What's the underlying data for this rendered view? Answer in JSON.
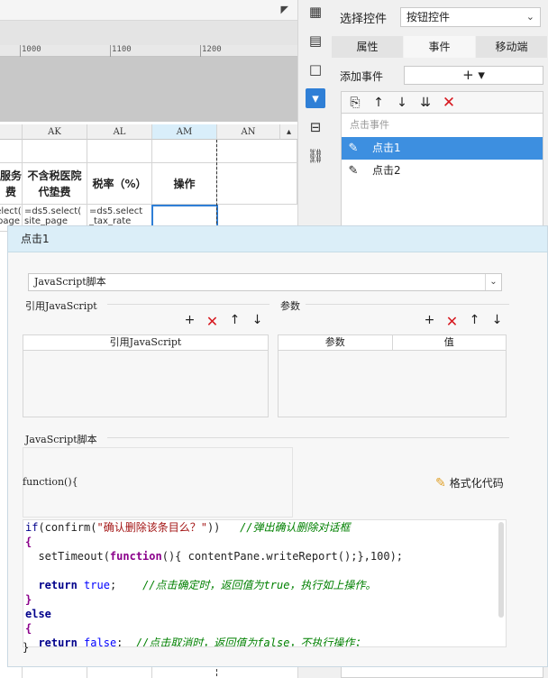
{
  "editor": {
    "ruler_labels": [
      "1000",
      "1100",
      "1200"
    ],
    "columns": [
      "AK",
      "AL",
      "AM",
      "AN"
    ],
    "header_cells": [
      "服务\n费",
      "不含税医院\n代垫费",
      "税率（%）",
      "操作"
    ],
    "formula_cells": [
      "select(\npage",
      "=ds5.select(\nsite_page",
      "=ds5.select\n_tax_rate"
    ]
  },
  "right_panel": {
    "select_label": "选择控件",
    "select_value": "按钮控件",
    "tabs": [
      "属性",
      "事件",
      "移动端"
    ],
    "active_tab": "事件",
    "add_event_label": "添加事件",
    "add_event_btn": "+ ▾",
    "event_list_header": "点击事件",
    "events": [
      "点击1",
      "点击2"
    ],
    "selected_event": "点击1"
  },
  "dialog": {
    "title": "点击1",
    "script_type": "JavaScript脚本",
    "ref_js_label": "引用JavaScript",
    "params_label": "参数",
    "ref_js_column": "引用JavaScript",
    "param_columns": [
      "参数",
      "值"
    ],
    "js_script_label": "JavaScript脚本",
    "func_header": "function(){",
    "format_btn": "格式化代码",
    "code_lines": [
      "if(confirm(\"确认删除该条目么？\"))   //弹出确认删除对话框",
      "{",
      "  setTimeout(function(){ contentPane.writeReport();},100);",
      "",
      "  return true;    //点击确定时，返回值为true，执行如上操作。",
      "}",
      "else",
      "{",
      "  return false;  //点击取消时，返回值为false，不执行操作；"
    ],
    "close_brace": "}"
  },
  "colors": {
    "accent": "#2f7fd6",
    "selected_row": "#3d8fe0",
    "dialog_title_bg": "#dbeef8",
    "delete_red": "#d71920"
  }
}
